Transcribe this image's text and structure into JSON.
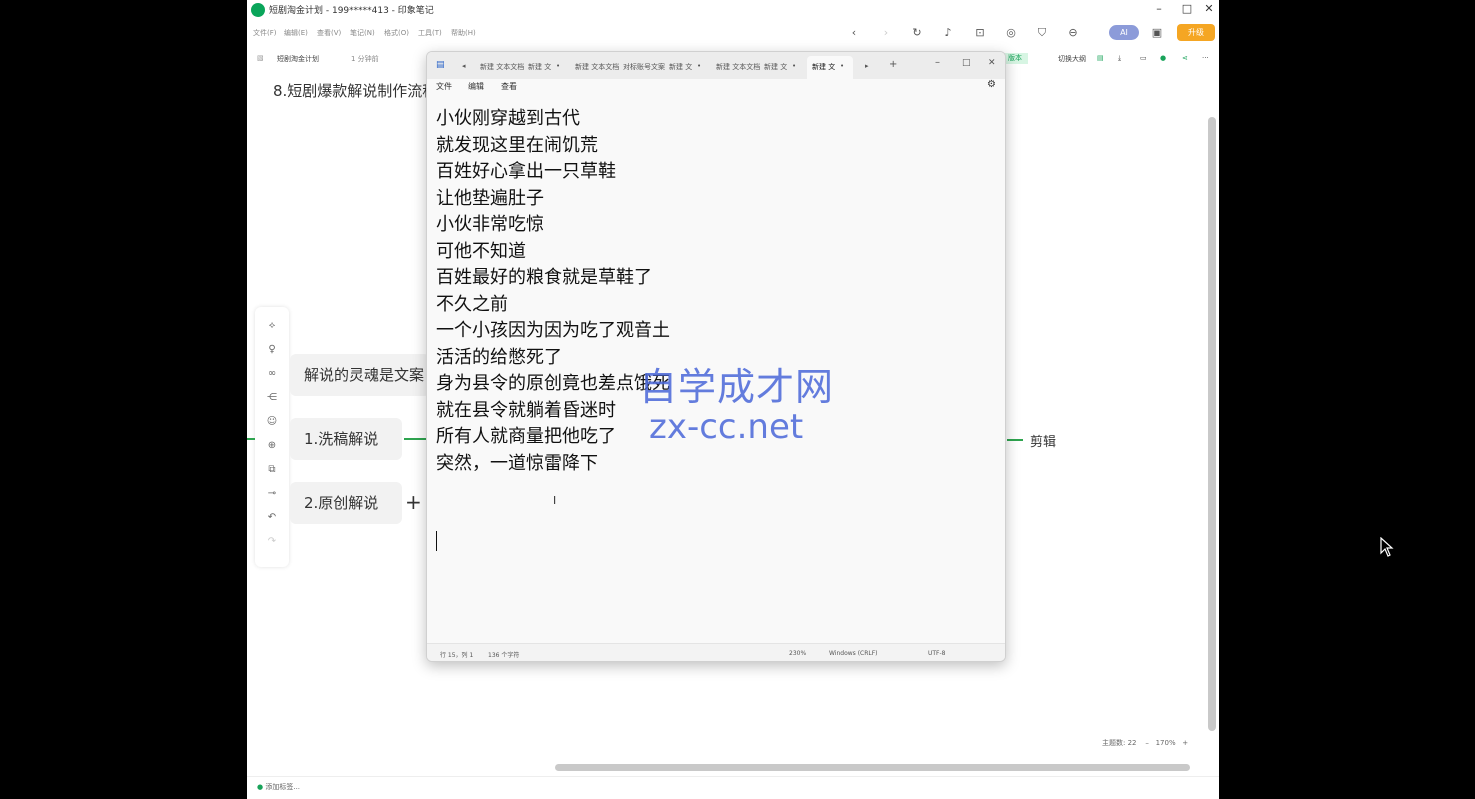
{
  "app": {
    "title": "短剧淘金计划 - 199*****413 - 印象笔记",
    "menu": [
      "文件(F)",
      "编辑(E)",
      "查看(V)",
      "笔记(N)",
      "格式(O)",
      "工具(T)",
      "帮助(H)"
    ],
    "ai_label": "AI",
    "upgrade_label": "升级",
    "notebook": "短剧淘金计划",
    "read_time": "1 分钟前",
    "outline_label": "切换大纲",
    "tag_label": "版本",
    "add_tag": "添加标签...",
    "topic_count": "主题数: 22",
    "zoom": "170%",
    "note_title": "8.短剧爆款解说制作流程"
  },
  "mindmap": {
    "center": "解说的灵魂是文案",
    "node1": "1.洗稿解说",
    "node2": "2.原创解说",
    "plus": "+",
    "right": "剪辑"
  },
  "notepad": {
    "tabs": [
      "新建 文本文档",
      "新建 文",
      "新建 文本文档",
      "对标账号文案",
      "新建 文",
      "新建 文本文档",
      "新建 文",
      "新建 文"
    ],
    "menu": [
      "文件",
      "编辑",
      "查看"
    ],
    "lines": [
      "小伙刚穿越到古代",
      "就发现这里在闹饥荒",
      "百姓好心拿出一只草鞋",
      "让他垫遍肚子",
      "小伙非常吃惊",
      "可他不知道",
      "百姓最好的粮食就是草鞋了",
      "不久之前",
      "一个小孩因为因为吃了观音土",
      "活活的给憋死了",
      "身为县令的原创竟也差点饿死",
      "就在县令就躺着昏迷时",
      "所有人就商量把他吃了",
      "突然，一道惊雷降下"
    ],
    "status": {
      "position": "行 15，列 1",
      "chars": "136 个字符",
      "zoom": "230%",
      "eol": "Windows (CRLF)",
      "encoding": "UTF-8"
    }
  },
  "watermark": {
    "cn": "自学成才网",
    "en": "zx-cc.net"
  },
  "colors": {
    "accent": "#2ea44f",
    "ai": "#8c9bd9",
    "upgrade": "#f5a623"
  }
}
